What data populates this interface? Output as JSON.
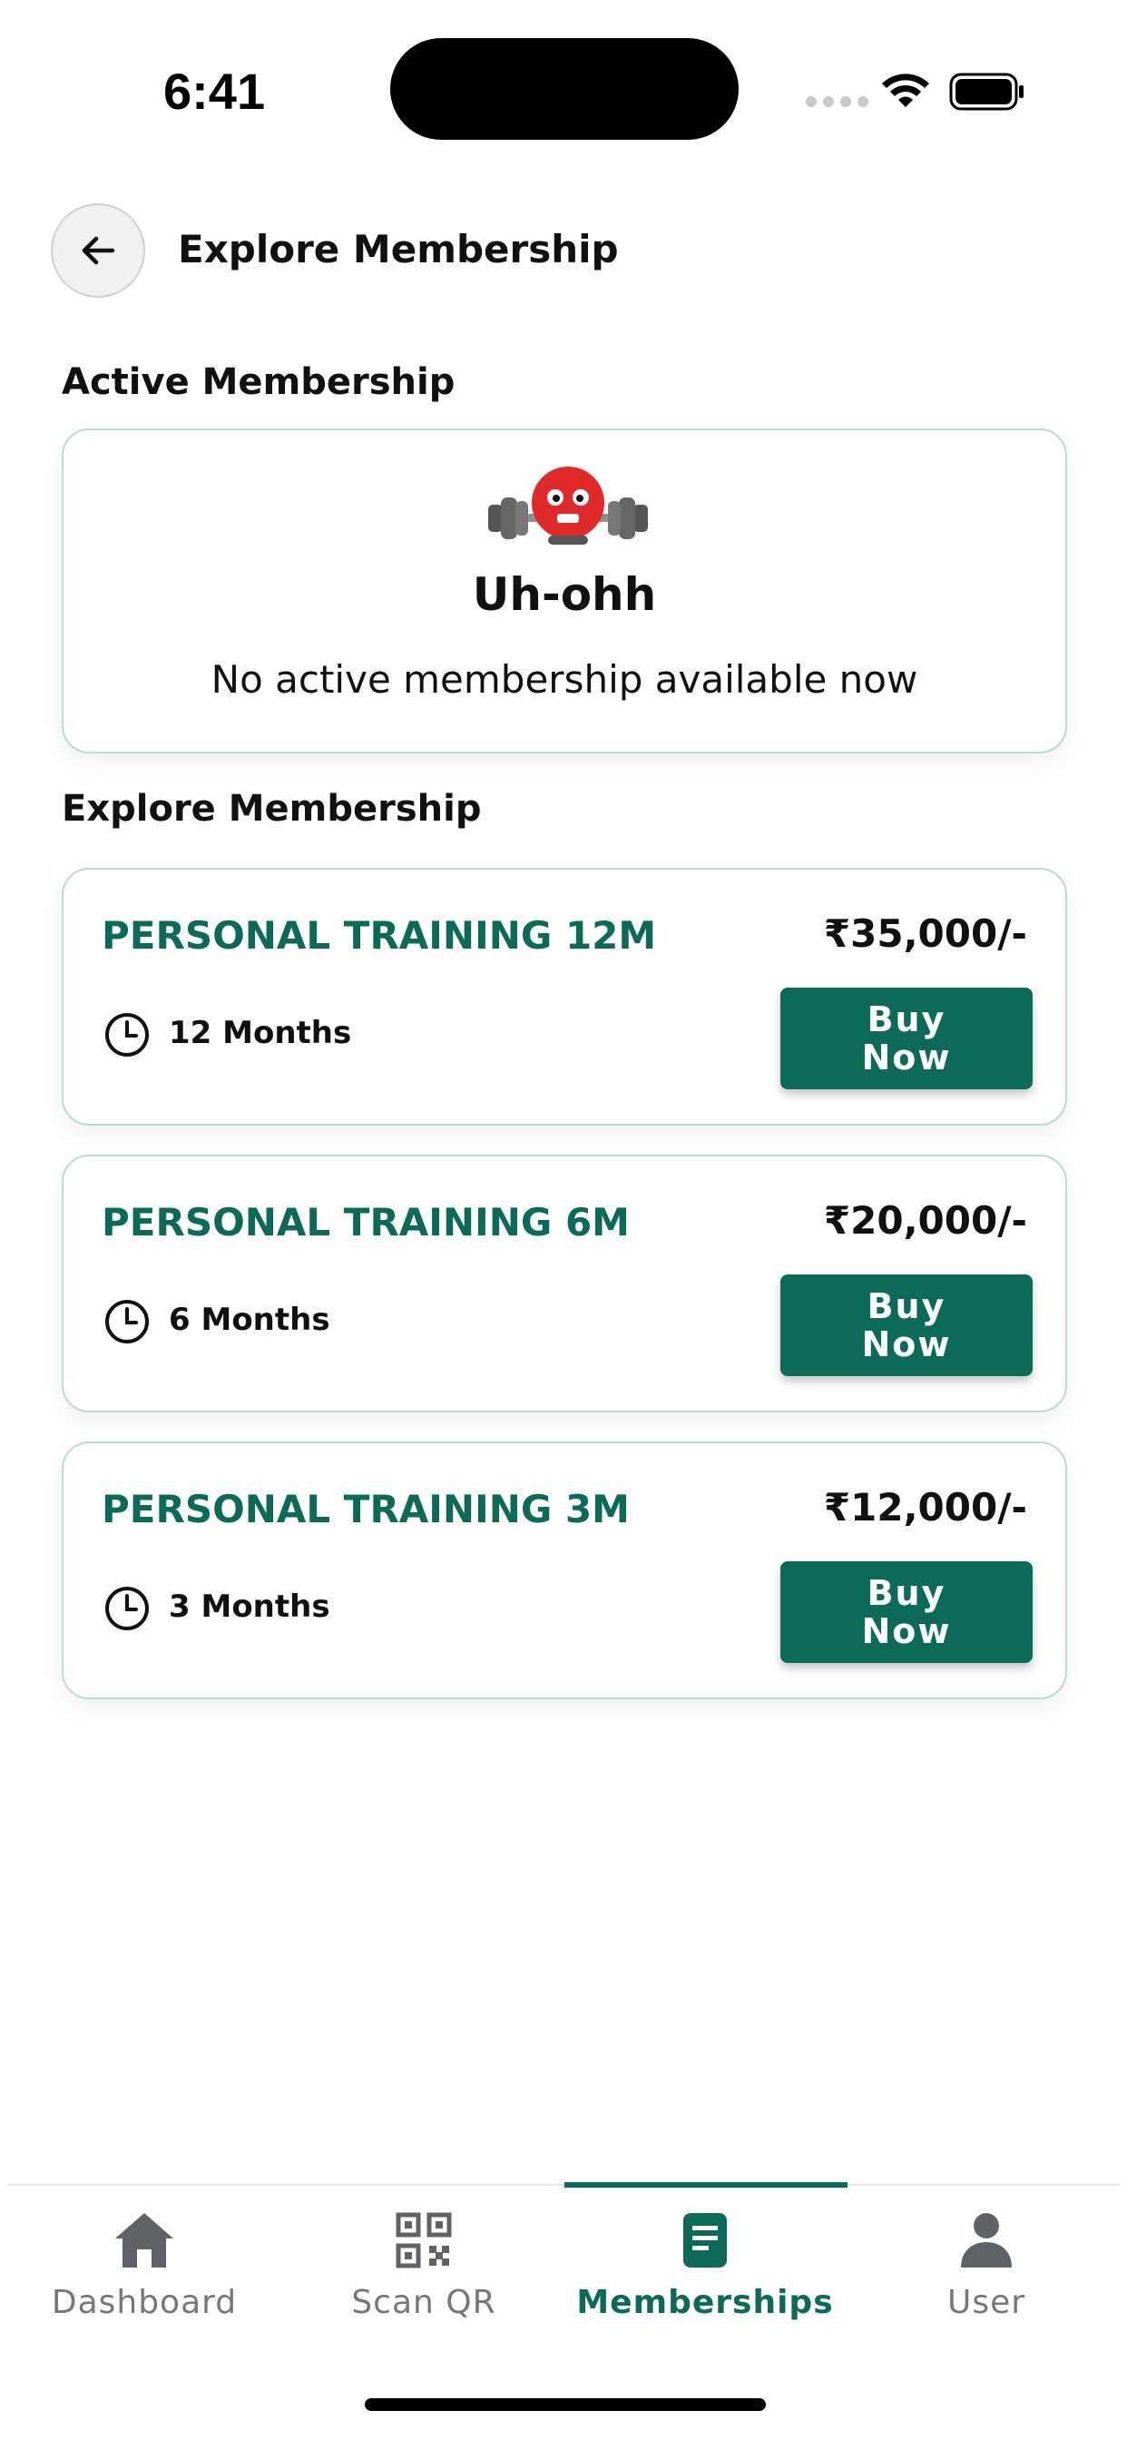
{
  "status_bar": {
    "time": "6:41"
  },
  "header": {
    "title": "Explore Membership",
    "back_icon": "arrow-left-icon"
  },
  "active_section": {
    "title": "Active Membership",
    "empty_title": "Uh-ohh",
    "empty_message": "No active membership available now"
  },
  "explore_section": {
    "title": "Explore Membership"
  },
  "plans": [
    {
      "name": "PERSONAL TRAINING 12M",
      "price": "₹35,000/-",
      "duration": "12 Months",
      "buy_line1": "Buy",
      "buy_line2": "Now"
    },
    {
      "name": "PERSONAL TRAINING 6M",
      "price": "₹20,000/-",
      "duration": "6 Months",
      "buy_line1": "Buy",
      "buy_line2": "Now"
    },
    {
      "name": "PERSONAL TRAINING 3M",
      "price": "₹12,000/-",
      "duration": "3 Months",
      "buy_line1": "Buy",
      "buy_line2": "Now"
    }
  ],
  "bottom_nav": {
    "items": [
      {
        "label": "Dashboard",
        "icon": "home-icon"
      },
      {
        "label": "Scan QR",
        "icon": "qr-code-icon"
      },
      {
        "label": "Memberships",
        "icon": "document-icon",
        "active": true
      },
      {
        "label": "User",
        "icon": "user-icon"
      }
    ]
  },
  "colors": {
    "accent": "#0b6b58",
    "card_border": "#b8ddd0",
    "inactive": "#777777"
  }
}
